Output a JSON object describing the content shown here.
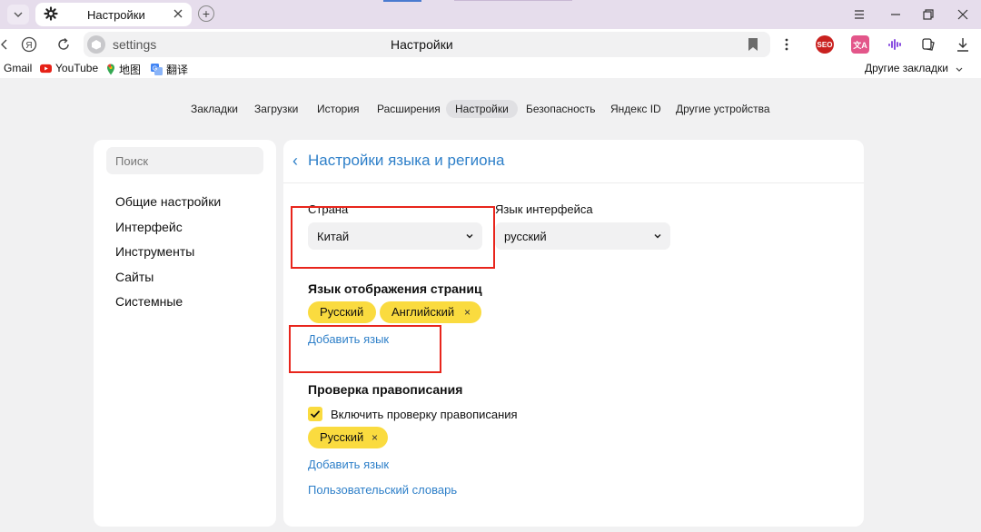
{
  "browser": {
    "tab": {
      "title": "Настройки"
    },
    "new_tab_glyph": "+",
    "address": {
      "url_text": "settings",
      "page_title": "Настройки"
    },
    "extensions": [
      "SEO",
      "文A",
      "audio",
      "ocr"
    ],
    "bookmarks": [
      {
        "label": "Gmail",
        "icon": "gmail-icon"
      },
      {
        "label": "YouTube",
        "icon": "youtube-icon"
      },
      {
        "label": "地图",
        "icon": "maps-pin-icon"
      },
      {
        "label": "翻译",
        "icon": "translate-icon"
      }
    ],
    "other_bookmarks": "Другие закладки"
  },
  "nav": {
    "items": [
      {
        "label": "Закладки"
      },
      {
        "label": "Загрузки"
      },
      {
        "label": "История"
      },
      {
        "label": "Расширения"
      },
      {
        "label": "Настройки",
        "active": true
      },
      {
        "label": "Безопасность"
      },
      {
        "label": "Яндекс ID"
      },
      {
        "label": "Другие устройства"
      }
    ]
  },
  "sidebar": {
    "search_placeholder": "Поиск",
    "items": [
      {
        "label": "Общие настройки"
      },
      {
        "label": "Интерфейс"
      },
      {
        "label": "Инструменты"
      },
      {
        "label": "Сайты"
      },
      {
        "label": "Системные"
      }
    ]
  },
  "main": {
    "back_glyph": "‹",
    "title": "Настройки языка и региона",
    "country": {
      "label": "Страна",
      "value": "Китай"
    },
    "ui_language": {
      "label": "Язык интерфейса",
      "value": "русский"
    },
    "page_languages": {
      "title": "Язык отображения страниц",
      "chips": [
        {
          "label": "Русский",
          "removable": false
        },
        {
          "label": "Английский",
          "removable": true
        }
      ],
      "add_link": "Добавить язык"
    },
    "spellcheck": {
      "title": "Проверка правописания",
      "enable_label": "Включить проверку правописания",
      "enabled": true,
      "chips": [
        {
          "label": "Русский",
          "removable": true
        }
      ],
      "add_link": "Добавить язык",
      "dictionary_link": "Пользовательский словарь"
    }
  },
  "colors": {
    "accent_yellow": "#fadb3f",
    "link_blue": "#2f80c9",
    "annotation_red": "#e8251c",
    "tabstrip": "#e6ddec"
  },
  "remove_glyph": "×"
}
